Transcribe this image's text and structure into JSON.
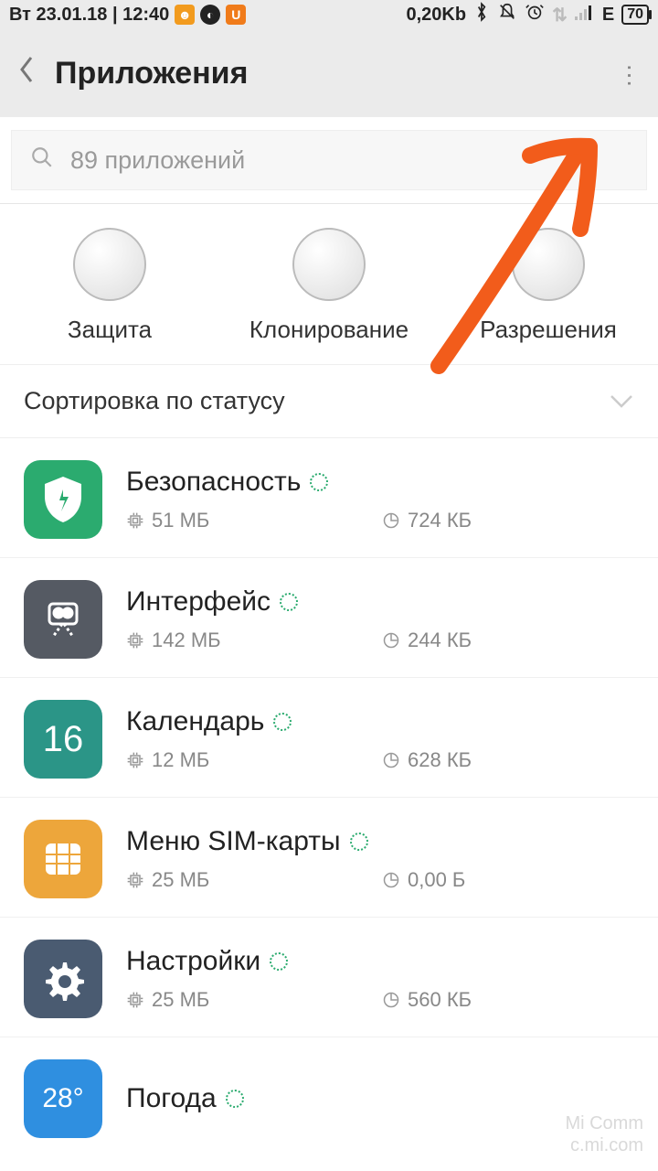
{
  "status": {
    "date_time": "Вт 23.01.18 | 12:40",
    "data": "0,20Kb",
    "network": "E",
    "battery": "70"
  },
  "header": {
    "title": "Приложения"
  },
  "search": {
    "placeholder": "89 приложений"
  },
  "shortcuts": [
    {
      "label": "Защита"
    },
    {
      "label": "Клонирование"
    },
    {
      "label": "Разрешения"
    }
  ],
  "sort": {
    "label": "Сортировка по статусу"
  },
  "apps": [
    {
      "name": "Безопасность",
      "storage": "51 МБ",
      "cache": "724 КБ",
      "icon": "security",
      "icon_text": ""
    },
    {
      "name": "Интерфейс",
      "storage": "142 МБ",
      "cache": "244 КБ",
      "icon": "interface",
      "icon_text": ""
    },
    {
      "name": "Календарь",
      "storage": "12 МБ",
      "cache": "628 КБ",
      "icon": "calendar",
      "icon_text": "16"
    },
    {
      "name": "Меню SIM-карты",
      "storage": "25 МБ",
      "cache": "0,00 Б",
      "icon": "sim",
      "icon_text": ""
    },
    {
      "name": "Настройки",
      "storage": "25 МБ",
      "cache": "560 КБ",
      "icon": "settings",
      "icon_text": ""
    },
    {
      "name": "Погода",
      "storage": "",
      "cache": "",
      "icon": "weather",
      "icon_text": "28°"
    }
  ],
  "watermark": {
    "line1": "Mi Comm",
    "line2": "c.mi.com"
  }
}
